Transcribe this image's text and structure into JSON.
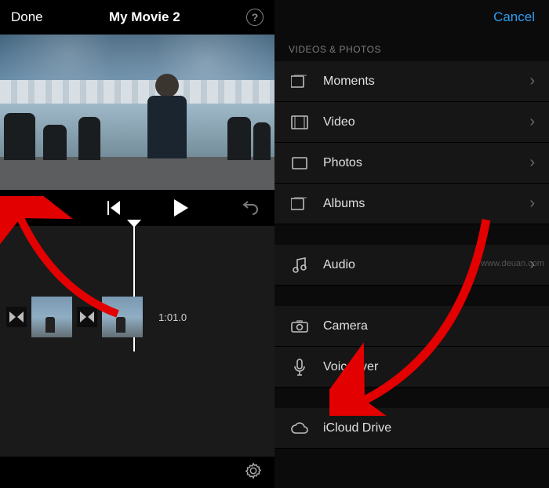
{
  "left": {
    "done_label": "Done",
    "title": "My Movie 2",
    "help_glyph": "?",
    "add_glyph": "+",
    "playhead_time": "1:01.0"
  },
  "right": {
    "cancel_label": "Cancel",
    "section_header": "VIDEOS & PHOTOS",
    "rows_media": [
      {
        "icon": "moments-icon",
        "label": "Moments",
        "chevron": true
      },
      {
        "icon": "video-icon",
        "label": "Video",
        "chevron": true
      },
      {
        "icon": "photos-icon",
        "label": "Photos",
        "chevron": true
      },
      {
        "icon": "albums-icon",
        "label": "Albums",
        "chevron": true
      }
    ],
    "rows_audio": [
      {
        "icon": "audio-icon",
        "label": "Audio",
        "chevron": true
      }
    ],
    "rows_capture": [
      {
        "icon": "camera-icon",
        "label": "Camera",
        "chevron": false
      },
      {
        "icon": "voiceover-icon",
        "label": "Voiceover",
        "chevron": false
      }
    ],
    "rows_cloud": [
      {
        "icon": "icloud-icon",
        "label": "iCloud Drive",
        "chevron": false
      }
    ]
  },
  "watermark": "www.deuan.com"
}
